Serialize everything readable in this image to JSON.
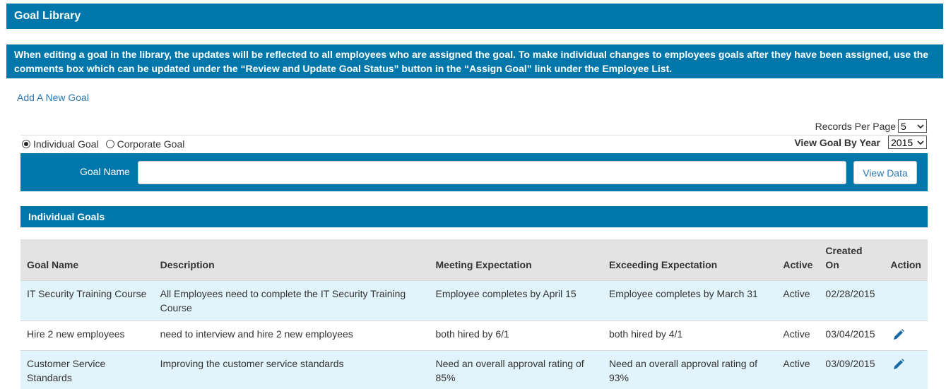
{
  "header": {
    "title": "Goal Library"
  },
  "banner": {
    "text": "When editing a goal in the library, the updates will be reflected to all employees who are assigned the goal. To make individual changes to employees goals after they have been assigned, use the comments box which can be updated under the “Review and Update Goal Status” button in the “Assign Goal” link under the Employee List."
  },
  "links": {
    "add_goal": "Add A New Goal"
  },
  "records": {
    "label": "Records Per Page",
    "value": "5"
  },
  "goal_type": {
    "individual": "Individual Goal",
    "corporate": "Corporate Goal",
    "selected": "individual"
  },
  "year": {
    "label": "View Goal By Year",
    "value": "2015"
  },
  "search": {
    "label": "Goal Name",
    "value": "",
    "button": "View Data"
  },
  "section": {
    "title": "Individual Goals"
  },
  "table": {
    "headers": {
      "goal_name": "Goal Name",
      "description": "Description",
      "meeting": "Meeting Expectation",
      "exceeding": "Exceeding Expectation",
      "active": "Active",
      "created_line1": "Created",
      "created_line2": "On",
      "action": "Action"
    },
    "rows": [
      {
        "goal_name": "IT Security Training Course",
        "description": "All Employees need to complete the IT Security Training Course",
        "meeting": "Employee completes by April 15",
        "exceeding": "Employee completes by March 31",
        "active": "Active",
        "created": "02/28/2015",
        "editable": false
      },
      {
        "goal_name": "Hire 2 new employees",
        "description": "need to interview and hire 2 new employees",
        "meeting": "both hired by 6/1",
        "exceeding": "both hired by 4/1",
        "active": "Active",
        "created": "03/04/2015",
        "editable": true
      },
      {
        "goal_name": "Customer Service Standards",
        "description": "Improving the customer service standards",
        "meeting": "Need an overall approval rating of 85%",
        "exceeding": "Need an overall approval rating of 93%",
        "active": "Active",
        "created": "03/09/2015",
        "editable": true
      }
    ]
  },
  "colors": {
    "primary": "#0077aa",
    "link": "#2a7ab8",
    "row_alt": "#e1f4fb",
    "table_header": "#e3e3e3"
  },
  "icons": {
    "edit": "pencil-icon",
    "dropdown": "chevron-down-icon"
  }
}
